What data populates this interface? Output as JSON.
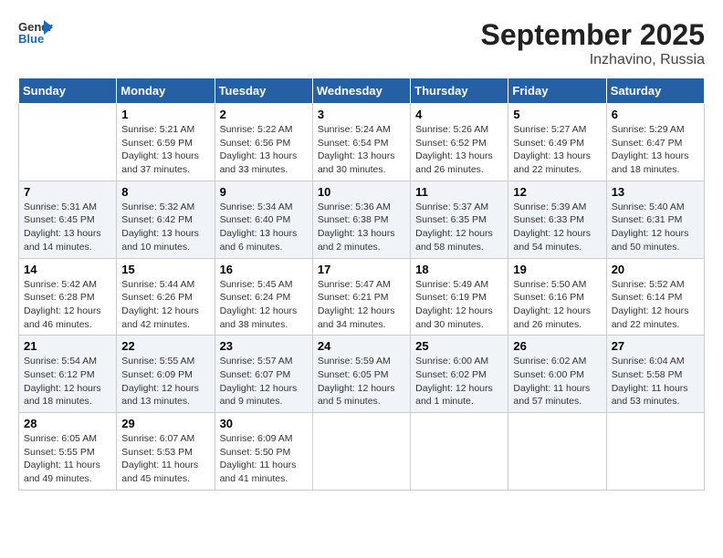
{
  "header": {
    "logo_general": "General",
    "logo_blue": "Blue",
    "month_title": "September 2025",
    "location": "Inzhavino, Russia"
  },
  "columns": [
    "Sunday",
    "Monday",
    "Tuesday",
    "Wednesday",
    "Thursday",
    "Friday",
    "Saturday"
  ],
  "weeks": [
    [
      {
        "day": "",
        "sunrise": "",
        "sunset": "",
        "daylight": ""
      },
      {
        "day": "1",
        "sunrise": "Sunrise: 5:21 AM",
        "sunset": "Sunset: 6:59 PM",
        "daylight": "Daylight: 13 hours and 37 minutes."
      },
      {
        "day": "2",
        "sunrise": "Sunrise: 5:22 AM",
        "sunset": "Sunset: 6:56 PM",
        "daylight": "Daylight: 13 hours and 33 minutes."
      },
      {
        "day": "3",
        "sunrise": "Sunrise: 5:24 AM",
        "sunset": "Sunset: 6:54 PM",
        "daylight": "Daylight: 13 hours and 30 minutes."
      },
      {
        "day": "4",
        "sunrise": "Sunrise: 5:26 AM",
        "sunset": "Sunset: 6:52 PM",
        "daylight": "Daylight: 13 hours and 26 minutes."
      },
      {
        "day": "5",
        "sunrise": "Sunrise: 5:27 AM",
        "sunset": "Sunset: 6:49 PM",
        "daylight": "Daylight: 13 hours and 22 minutes."
      },
      {
        "day": "6",
        "sunrise": "Sunrise: 5:29 AM",
        "sunset": "Sunset: 6:47 PM",
        "daylight": "Daylight: 13 hours and 18 minutes."
      }
    ],
    [
      {
        "day": "7",
        "sunrise": "Sunrise: 5:31 AM",
        "sunset": "Sunset: 6:45 PM",
        "daylight": "Daylight: 13 hours and 14 minutes."
      },
      {
        "day": "8",
        "sunrise": "Sunrise: 5:32 AM",
        "sunset": "Sunset: 6:42 PM",
        "daylight": "Daylight: 13 hours and 10 minutes."
      },
      {
        "day": "9",
        "sunrise": "Sunrise: 5:34 AM",
        "sunset": "Sunset: 6:40 PM",
        "daylight": "Daylight: 13 hours and 6 minutes."
      },
      {
        "day": "10",
        "sunrise": "Sunrise: 5:36 AM",
        "sunset": "Sunset: 6:38 PM",
        "daylight": "Daylight: 13 hours and 2 minutes."
      },
      {
        "day": "11",
        "sunrise": "Sunrise: 5:37 AM",
        "sunset": "Sunset: 6:35 PM",
        "daylight": "Daylight: 12 hours and 58 minutes."
      },
      {
        "day": "12",
        "sunrise": "Sunrise: 5:39 AM",
        "sunset": "Sunset: 6:33 PM",
        "daylight": "Daylight: 12 hours and 54 minutes."
      },
      {
        "day": "13",
        "sunrise": "Sunrise: 5:40 AM",
        "sunset": "Sunset: 6:31 PM",
        "daylight": "Daylight: 12 hours and 50 minutes."
      }
    ],
    [
      {
        "day": "14",
        "sunrise": "Sunrise: 5:42 AM",
        "sunset": "Sunset: 6:28 PM",
        "daylight": "Daylight: 12 hours and 46 minutes."
      },
      {
        "day": "15",
        "sunrise": "Sunrise: 5:44 AM",
        "sunset": "Sunset: 6:26 PM",
        "daylight": "Daylight: 12 hours and 42 minutes."
      },
      {
        "day": "16",
        "sunrise": "Sunrise: 5:45 AM",
        "sunset": "Sunset: 6:24 PM",
        "daylight": "Daylight: 12 hours and 38 minutes."
      },
      {
        "day": "17",
        "sunrise": "Sunrise: 5:47 AM",
        "sunset": "Sunset: 6:21 PM",
        "daylight": "Daylight: 12 hours and 34 minutes."
      },
      {
        "day": "18",
        "sunrise": "Sunrise: 5:49 AM",
        "sunset": "Sunset: 6:19 PM",
        "daylight": "Daylight: 12 hours and 30 minutes."
      },
      {
        "day": "19",
        "sunrise": "Sunrise: 5:50 AM",
        "sunset": "Sunset: 6:16 PM",
        "daylight": "Daylight: 12 hours and 26 minutes."
      },
      {
        "day": "20",
        "sunrise": "Sunrise: 5:52 AM",
        "sunset": "Sunset: 6:14 PM",
        "daylight": "Daylight: 12 hours and 22 minutes."
      }
    ],
    [
      {
        "day": "21",
        "sunrise": "Sunrise: 5:54 AM",
        "sunset": "Sunset: 6:12 PM",
        "daylight": "Daylight: 12 hours and 18 minutes."
      },
      {
        "day": "22",
        "sunrise": "Sunrise: 5:55 AM",
        "sunset": "Sunset: 6:09 PM",
        "daylight": "Daylight: 12 hours and 13 minutes."
      },
      {
        "day": "23",
        "sunrise": "Sunrise: 5:57 AM",
        "sunset": "Sunset: 6:07 PM",
        "daylight": "Daylight: 12 hours and 9 minutes."
      },
      {
        "day": "24",
        "sunrise": "Sunrise: 5:59 AM",
        "sunset": "Sunset: 6:05 PM",
        "daylight": "Daylight: 12 hours and 5 minutes."
      },
      {
        "day": "25",
        "sunrise": "Sunrise: 6:00 AM",
        "sunset": "Sunset: 6:02 PM",
        "daylight": "Daylight: 12 hours and 1 minute."
      },
      {
        "day": "26",
        "sunrise": "Sunrise: 6:02 AM",
        "sunset": "Sunset: 6:00 PM",
        "daylight": "Daylight: 11 hours and 57 minutes."
      },
      {
        "day": "27",
        "sunrise": "Sunrise: 6:04 AM",
        "sunset": "Sunset: 5:58 PM",
        "daylight": "Daylight: 11 hours and 53 minutes."
      }
    ],
    [
      {
        "day": "28",
        "sunrise": "Sunrise: 6:05 AM",
        "sunset": "Sunset: 5:55 PM",
        "daylight": "Daylight: 11 hours and 49 minutes."
      },
      {
        "day": "29",
        "sunrise": "Sunrise: 6:07 AM",
        "sunset": "Sunset: 5:53 PM",
        "daylight": "Daylight: 11 hours and 45 minutes."
      },
      {
        "day": "30",
        "sunrise": "Sunrise: 6:09 AM",
        "sunset": "Sunset: 5:50 PM",
        "daylight": "Daylight: 11 hours and 41 minutes."
      },
      {
        "day": "",
        "sunrise": "",
        "sunset": "",
        "daylight": ""
      },
      {
        "day": "",
        "sunrise": "",
        "sunset": "",
        "daylight": ""
      },
      {
        "day": "",
        "sunrise": "",
        "sunset": "",
        "daylight": ""
      },
      {
        "day": "",
        "sunrise": "",
        "sunset": "",
        "daylight": ""
      }
    ]
  ]
}
